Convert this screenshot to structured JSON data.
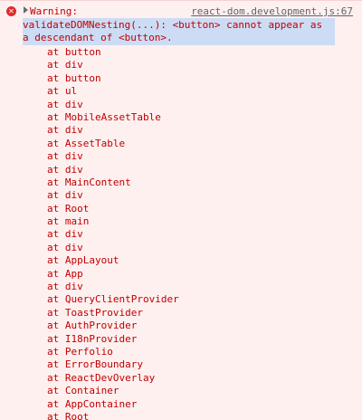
{
  "entry": {
    "level_icon": "error-circle-icon",
    "warning_label": "Warning:",
    "source": "react-dom.development.js:67",
    "message_line1": "validateDOMNesting(...): <button> cannot appear as",
    "message_line2": "a descendant of <button>."
  },
  "stack_prefix": "at",
  "stack_frames": [
    "button",
    "div",
    "button",
    "ul",
    "div",
    "MobileAssetTable",
    "div",
    "AssetTable",
    "div",
    "div",
    "MainContent",
    "div",
    "Root",
    "main",
    "div",
    "div",
    "AppLayout",
    "App",
    "div",
    "QueryClientProvider",
    "ToastProvider",
    "AuthProvider",
    "I18nProvider",
    "Perfolio",
    "ErrorBoundary",
    "ReactDevOverlay",
    "Container",
    "AppContainer",
    "Root"
  ],
  "colors": {
    "background": "#fff0f0",
    "error_text": "#c00000",
    "selection": "#cddcf5",
    "link": "#5f6368"
  }
}
